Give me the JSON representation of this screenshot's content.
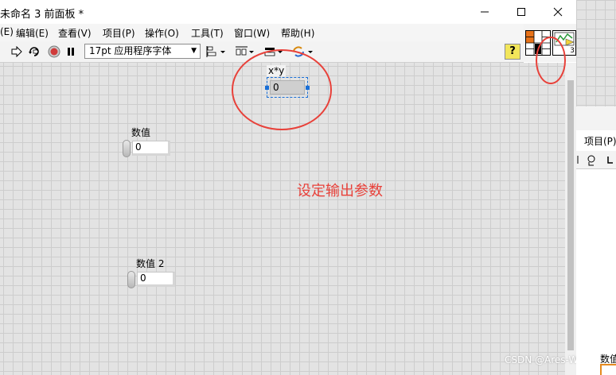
{
  "window": {
    "title": "未命名 3 前面板 *"
  },
  "menu": [
    "(E)",
    "编辑(E)",
    "查看(V)",
    "项目(P)",
    "操作(O)",
    "工具(T)",
    "窗口(W)",
    "帮助(H)"
  ],
  "toolbar": {
    "font": "17pt 应用程序字体",
    "help": "?"
  },
  "panel": {
    "indicator": {
      "label": "x*y",
      "value": "0"
    },
    "control1": {
      "label": "数值",
      "value": "0"
    },
    "control2": {
      "label": "数值 2",
      "value": "0"
    },
    "annotation": "设定输出参数"
  },
  "connector_icon_badge": "3",
  "watermark": "CSDN @Ares-Wang",
  "background_window": {
    "menu_item": "项目(P)",
    "label": "数值"
  },
  "colors": {
    "annotation_red": "#e8413a",
    "selection_blue": "#1a6fd6",
    "panel_grid": "#e3e3e3"
  }
}
